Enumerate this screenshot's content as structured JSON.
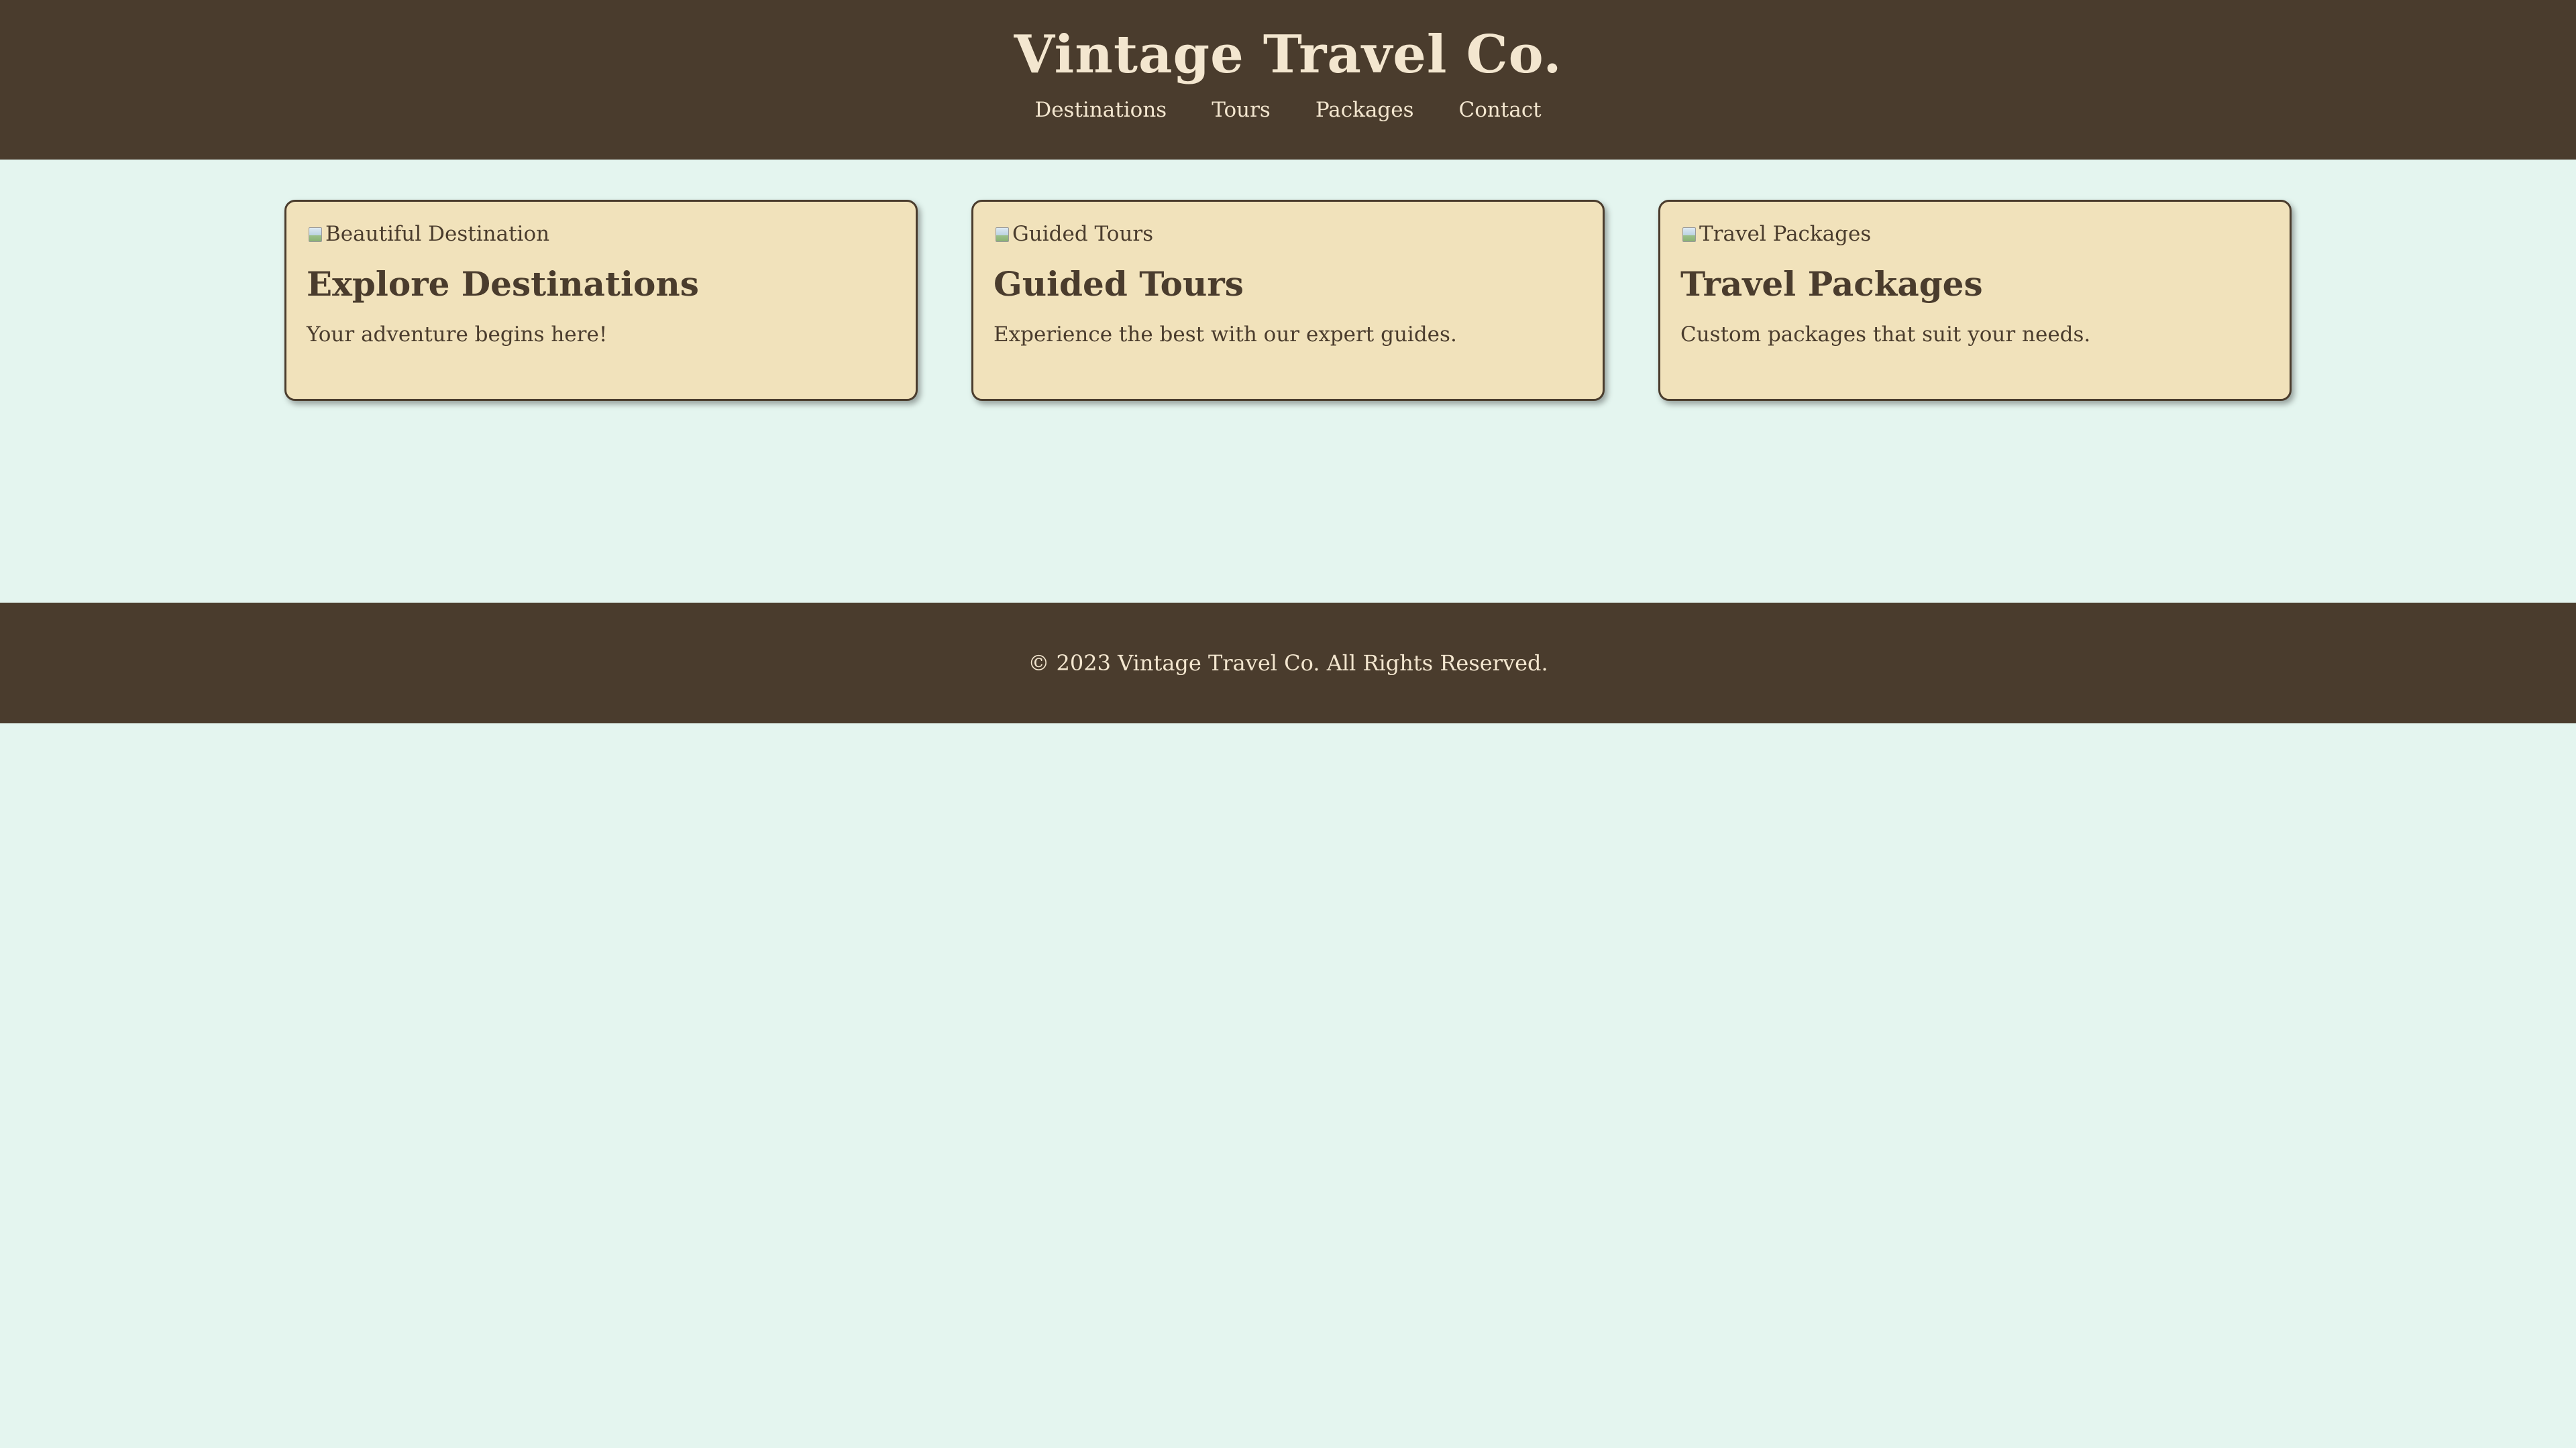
{
  "header": {
    "title": "Vintage Travel Co.",
    "nav": [
      "Destinations",
      "Tours",
      "Packages",
      "Contact"
    ]
  },
  "cards": [
    {
      "image_alt": "Beautiful Destination",
      "title": "Explore Destinations",
      "text": "Your adventure begins here!"
    },
    {
      "image_alt": "Guided Tours",
      "title": "Guided Tours",
      "text": "Experience the best with our expert guides."
    },
    {
      "image_alt": "Travel Packages",
      "title": "Travel Packages",
      "text": "Custom packages that suit your needs."
    }
  ],
  "footer": {
    "copyright": "© 2023 Vintage Travel Co. All Rights Reserved."
  },
  "colors": {
    "header_bg": "#4a3c2d",
    "header_text": "#f3e6cf",
    "page_bg": "#e4f5ef",
    "card_bg": "#f1e2bb"
  }
}
